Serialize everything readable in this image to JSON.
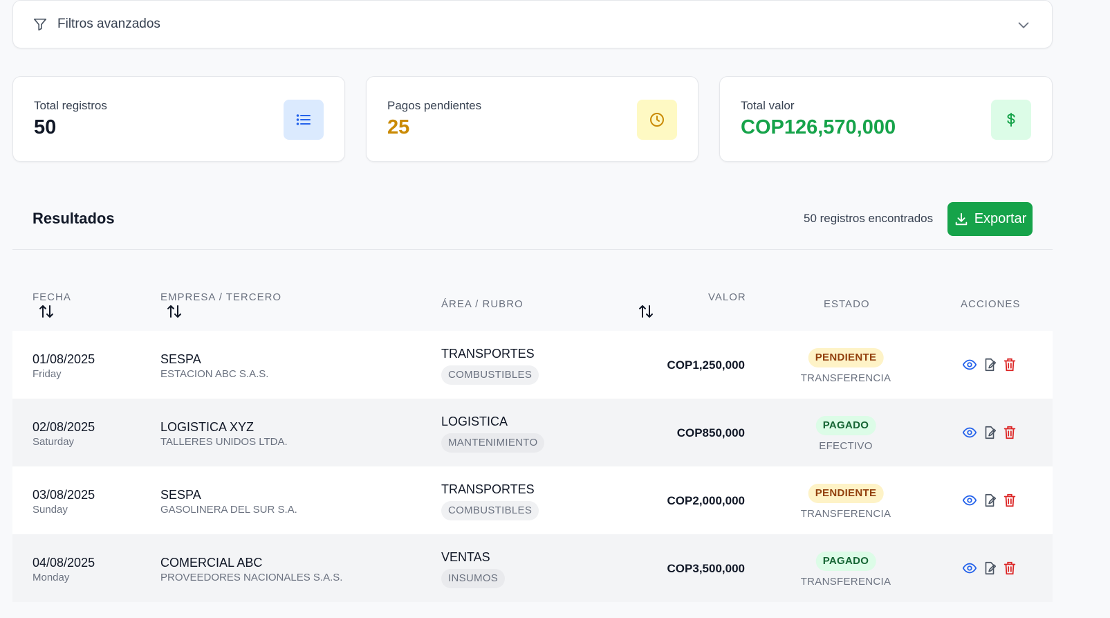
{
  "filters": {
    "label": "Filtros avanzados",
    "icon": "funnel-icon",
    "toggle_icon": "chevron-down-icon"
  },
  "stats": [
    {
      "label": "Total registros",
      "value": "50",
      "icon": "list-icon",
      "value_color": "#111827",
      "icon_bg": "#dbeafe"
    },
    {
      "label": "Pagos pendientes",
      "value": "25",
      "icon": "clock-icon",
      "value_color": "#ca8a04",
      "icon_bg": "#fef9c3"
    },
    {
      "label": "Total valor",
      "value": "COP126,570,000",
      "icon": "dollar-icon",
      "value_color": "#16a34a",
      "icon_bg": "#dcfce7"
    }
  ],
  "results": {
    "title": "Resultados",
    "count_text": "50 registros encontrados",
    "export_label": "Exportar",
    "export_icon": "download-icon"
  },
  "table": {
    "headers": {
      "fecha": "FECHA",
      "empresa": "EMPRESA / TERCERO",
      "area": "ÁREA / RUBRO",
      "valor": "VALOR",
      "estado": "ESTADO",
      "acciones": "ACCIONES"
    },
    "rows": [
      {
        "fecha": "01/08/2025",
        "dia": "Friday",
        "empresa": "SESPA",
        "tercero": "ESTACION ABC S.A.S.",
        "area": "TRANSPORTES",
        "rubro": "COMBUSTIBLES",
        "valor": "COP1,250,000",
        "estado": "PENDIENTE",
        "metodo": "TRANSFERENCIA"
      },
      {
        "fecha": "02/08/2025",
        "dia": "Saturday",
        "empresa": "LOGISTICA XYZ",
        "tercero": "TALLERES UNIDOS LTDA.",
        "area": "LOGISTICA",
        "rubro": "MANTENIMIENTO",
        "valor": "COP850,000",
        "estado": "PAGADO",
        "metodo": "EFECTIVO"
      },
      {
        "fecha": "03/08/2025",
        "dia": "Sunday",
        "empresa": "SESPA",
        "tercero": "GASOLINERA DEL SUR S.A.",
        "area": "TRANSPORTES",
        "rubro": "COMBUSTIBLES",
        "valor": "COP2,000,000",
        "estado": "PENDIENTE",
        "metodo": "TRANSFERENCIA"
      },
      {
        "fecha": "04/08/2025",
        "dia": "Monday",
        "empresa": "COMERCIAL ABC",
        "tercero": "PROVEEDORES NACIONALES S.A.S.",
        "area": "VENTAS",
        "rubro": "INSUMOS",
        "valor": "COP3,500,000",
        "estado": "PAGADO",
        "metodo": "TRANSFERENCIA"
      }
    ],
    "row_actions": [
      "eye-icon",
      "edit-icon",
      "trash-icon"
    ]
  },
  "colors": {
    "accent_green": "#16a34a",
    "action_blue": "#2563eb",
    "danger_red": "#dc2626"
  }
}
